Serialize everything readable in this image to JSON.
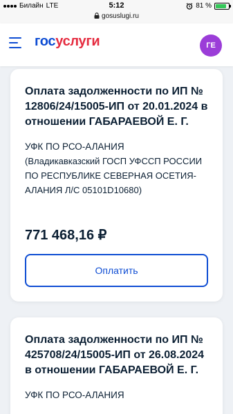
{
  "status_bar": {
    "carrier": "Билайн",
    "network": "LTE",
    "time": "5:12",
    "battery_percent_label": "81 %",
    "battery_level": 0.81
  },
  "url_bar": {
    "url": "gosuslugi.ru"
  },
  "header": {
    "logo_part1": "гос",
    "logo_part2": "услуги",
    "avatar_initials": "ГЕ"
  },
  "payments": [
    {
      "title": "Оплата задолженности по ИП № 12806/24/15005-ИП от 20.01.2024 в отношении ГАБАРАЕВОЙ Е. Г.",
      "recipient": "УФК ПО РСО-АЛАНИЯ",
      "recipient_detail": "(Владикавказский ГОСП УФССП РОССИИ ПО РЕСПУБЛИКЕ СЕВЕРНАЯ ОСЕТИЯ-АЛАНИЯ Л/С 05101D10680)",
      "amount": "771 468,16 ₽",
      "pay_label": "Оплатить"
    },
    {
      "title": "Оплата задолженности по ИП № 425708/24/15005-ИП от 26.08.2024 в отношении ГАБАРАЕВОЙ Е. Г.",
      "recipient": "УФК ПО РСО-АЛАНИЯ"
    }
  ],
  "colors": {
    "brand_blue": "#0d4cd3",
    "brand_red": "#e52b3f",
    "avatar_bg": "#9b3dd8",
    "battery_green": "#34c759"
  }
}
